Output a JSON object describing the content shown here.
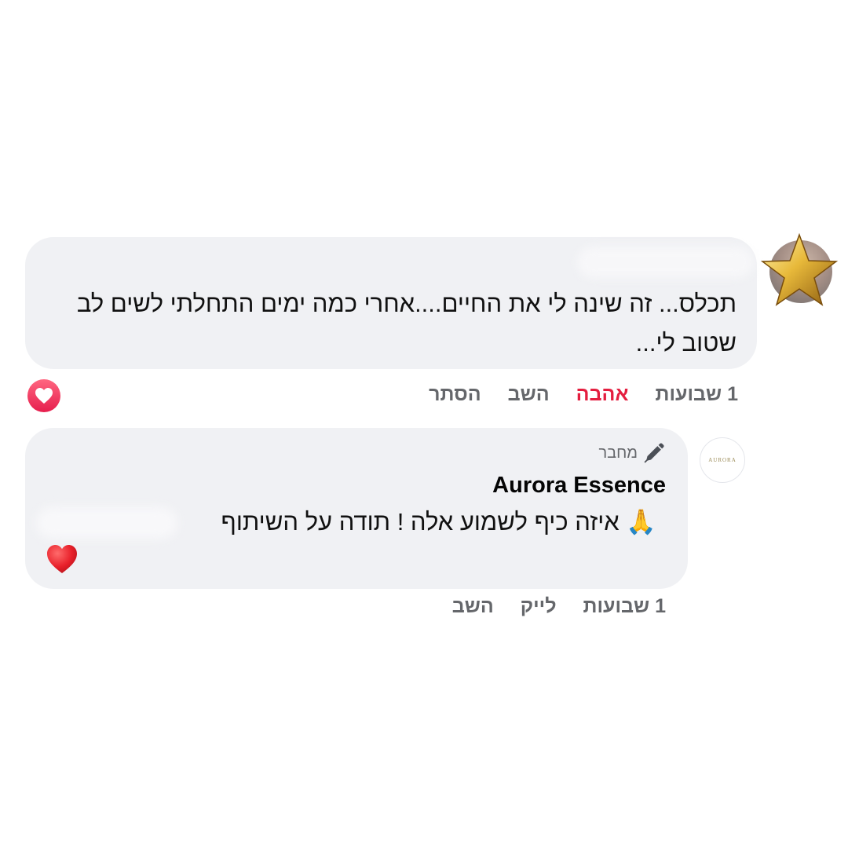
{
  "comments": [
    {
      "text": "תכלס... זה שינה לי את החיים....אחרי כמה ימים התחלתי לשים לב שטוב לי...",
      "actions": {
        "time": "1 שבועות",
        "love": "אהבה",
        "reply": "השב",
        "hide": "הסתר"
      },
      "reaction_icon": "heart-reaction-icon",
      "avatar_overlay_icon": "star-icon",
      "colors": {
        "love": "#e41e3f",
        "bubble": "#f0f1f4"
      }
    },
    {
      "author_badge": "מחבר",
      "author_name": "Aurora Essence",
      "avatar_text": "AURORA",
      "text": "🙏 איזה כיף לשמוע אלה ! תודה על השיתוף",
      "actions": {
        "time": "1 שבועות",
        "like": "לייק",
        "reply": "השב"
      },
      "reaction_icon": "red-heart-icon",
      "colors": {
        "action_text": "#65676b"
      }
    }
  ]
}
